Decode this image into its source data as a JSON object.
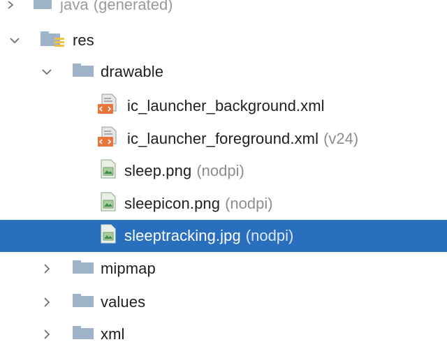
{
  "tree": {
    "partial_top": {
      "label": "java",
      "suffix": "(generated)"
    },
    "res": {
      "label": "res",
      "expanded": true
    },
    "drawable": {
      "label": "drawable",
      "expanded": true
    },
    "files": [
      {
        "label": "ic_launcher_background.xml",
        "suffix": "",
        "icon": "xml-file-icon"
      },
      {
        "label": "ic_launcher_foreground.xml",
        "suffix": "(v24)",
        "icon": "xml-file-icon"
      },
      {
        "label": "sleep.png",
        "suffix": "(nodpi)",
        "icon": "image-file-icon"
      },
      {
        "label": "sleepicon.png",
        "suffix": "(nodpi)",
        "icon": "image-file-icon"
      },
      {
        "label": "sleeptracking.jpg",
        "suffix": "(nodpi)",
        "icon": "image-file-icon",
        "selected": true
      }
    ],
    "collapsed_folders": [
      {
        "label": "mipmap"
      },
      {
        "label": "values"
      },
      {
        "label": "xml"
      }
    ]
  },
  "colors": {
    "selection": "#2a6fbe",
    "folder": "#9fb3c8",
    "xml_badge": "#e8763a",
    "suffix": "#8d8d8d"
  }
}
